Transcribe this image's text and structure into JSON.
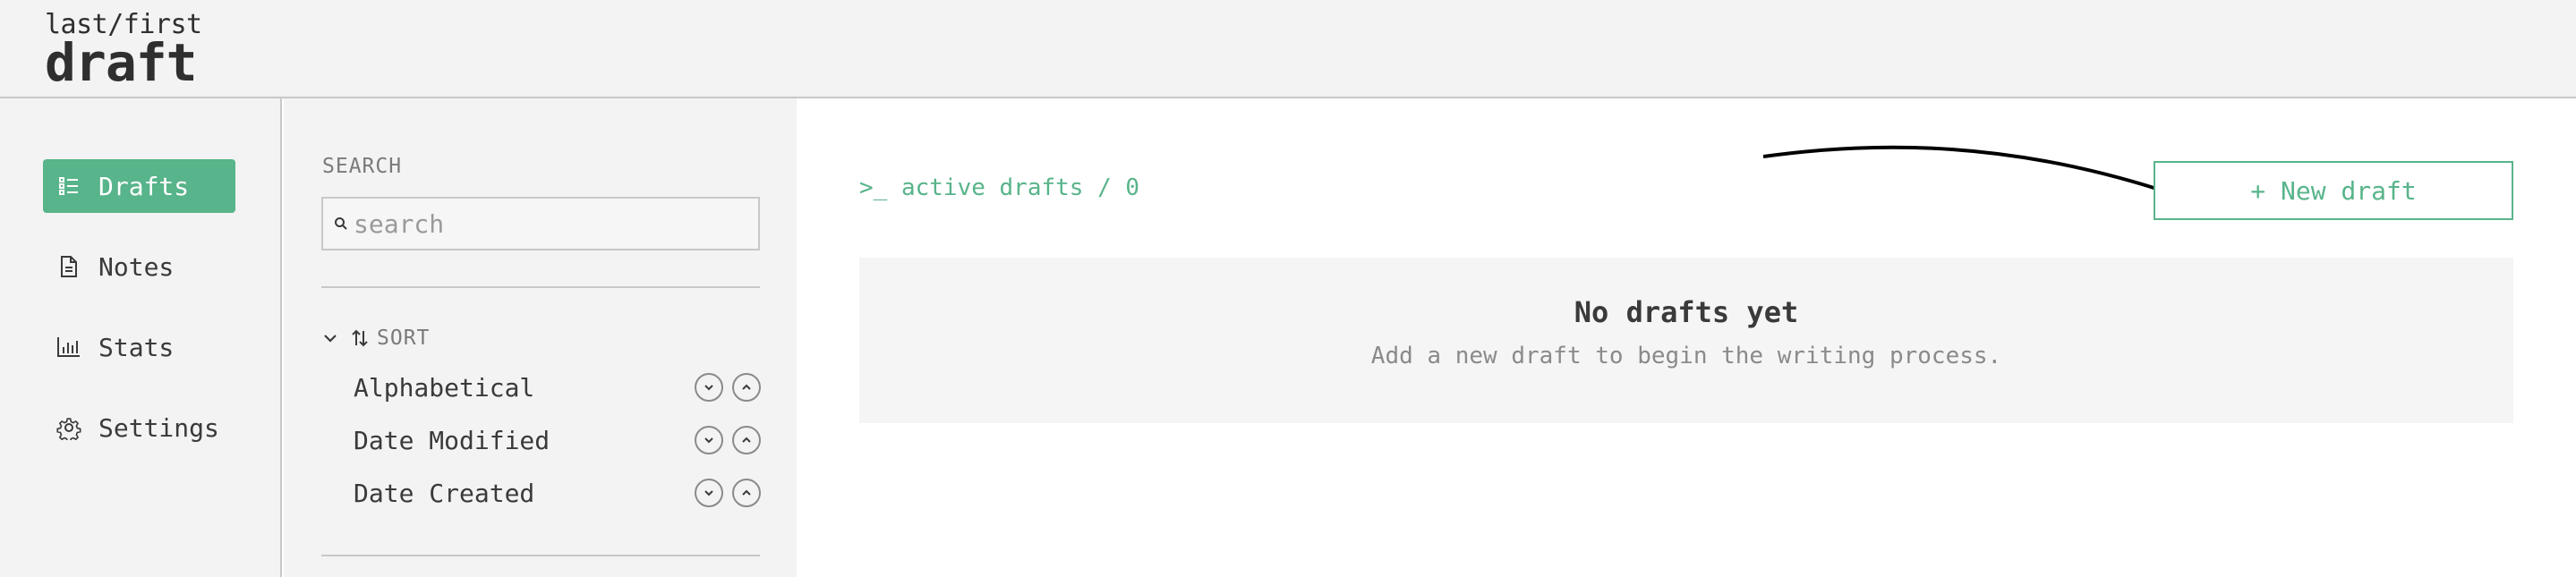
{
  "logo": {
    "top": "last/first",
    "bottom": "draft"
  },
  "nav": {
    "items": [
      {
        "label": "Drafts",
        "icon": "list-icon",
        "active": true
      },
      {
        "label": "Notes",
        "icon": "document-icon",
        "active": false
      },
      {
        "label": "Stats",
        "icon": "bar-chart-icon",
        "active": false
      },
      {
        "label": "Settings",
        "icon": "gear-icon",
        "active": false
      }
    ]
  },
  "filters": {
    "search_label": "SEARCH",
    "search_placeholder": "search",
    "search_value": "",
    "sort_label": "SORT",
    "sort_options": [
      {
        "label": "Alphabetical"
      },
      {
        "label": "Date Modified"
      },
      {
        "label": "Date Created"
      }
    ]
  },
  "main": {
    "breadcrumb": ">_ active drafts / 0",
    "new_button_label": "+ New draft",
    "empty_title": "No drafts yet",
    "empty_subtitle": "Add a new draft to begin the writing process."
  },
  "colors": {
    "accent": "#58b48a",
    "panel_bg": "#f3f3f3",
    "border": "#c8c8c8"
  }
}
